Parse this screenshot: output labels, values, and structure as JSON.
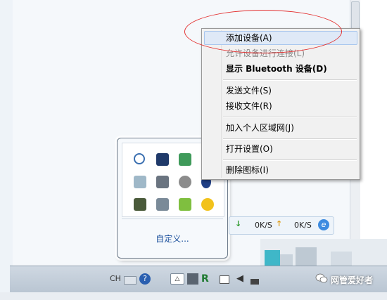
{
  "context_menu": {
    "items": [
      {
        "label": "添加设备(A)"
      },
      {
        "label": "允许设备进行连接(L)"
      },
      {
        "label": "显示 Bluetooth 设备(D)"
      },
      {
        "label": "发送文件(S)"
      },
      {
        "label": "接收文件(R)"
      },
      {
        "label": "加入个人区域网(J)"
      },
      {
        "label": "打开设置(O)"
      },
      {
        "label": "删除图标(I)"
      }
    ]
  },
  "tray_popup": {
    "customize_label": "自定义...",
    "icons": [
      "search-magnifier-icon",
      "monitor-icon",
      "map-icon",
      "check-icon",
      "display-icon",
      "gray-circle-icon",
      "bluetooth-icon",
      "grid-icon",
      "usb-safe-remove-icon",
      "shield-icon",
      "green-plus-icon"
    ]
  },
  "speed": {
    "download": "0K/S",
    "upload": "0K/S"
  },
  "taskbar": {
    "lang": "CH"
  },
  "watermark": {
    "text": "网管爱好者"
  },
  "colors": {
    "annotation": "#e33030",
    "menu_highlight": "#dfe9f7",
    "link": "#1a4f9c"
  }
}
